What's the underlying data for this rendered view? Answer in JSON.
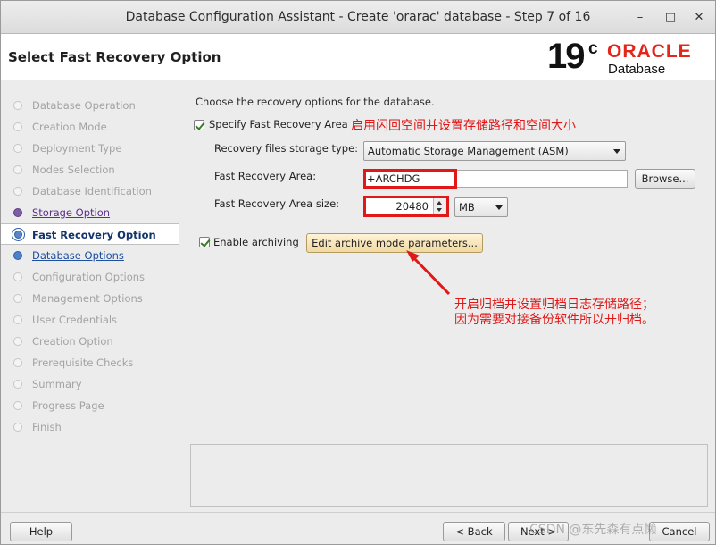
{
  "window": {
    "title": "Database Configuration Assistant - Create 'orarac' database - Step 7 of 16",
    "minimize_glyph": "–",
    "maximize_glyph": "□",
    "close_glyph": "✕"
  },
  "header": {
    "page_title": "Select Fast Recovery Option",
    "logo": {
      "version": "19",
      "suffix": "c",
      "brand": "ORACLE",
      "product": "Database",
      "brand_color": "#e3251b"
    }
  },
  "sidebar": {
    "steps": [
      {
        "label": "Database Operation",
        "state": "disabled"
      },
      {
        "label": "Creation Mode",
        "state": "disabled"
      },
      {
        "label": "Deployment Type",
        "state": "disabled"
      },
      {
        "label": "Nodes Selection",
        "state": "disabled"
      },
      {
        "label": "Database Identification",
        "state": "disabled"
      },
      {
        "label": "Storage Option",
        "state": "done"
      },
      {
        "label": "Fast Recovery Option",
        "state": "current"
      },
      {
        "label": "Database Options",
        "state": "next"
      },
      {
        "label": "Configuration Options",
        "state": "disabled"
      },
      {
        "label": "Management Options",
        "state": "disabled"
      },
      {
        "label": "User Credentials",
        "state": "disabled"
      },
      {
        "label": "Creation Option",
        "state": "disabled"
      },
      {
        "label": "Prerequisite Checks",
        "state": "disabled"
      },
      {
        "label": "Summary",
        "state": "disabled"
      },
      {
        "label": "Progress Page",
        "state": "disabled"
      },
      {
        "label": "Finish",
        "state": "disabled"
      }
    ]
  },
  "main": {
    "description": "Choose the recovery options for the database.",
    "fra_checkbox": {
      "label": "Specify Fast Recovery Area",
      "checked": true
    },
    "fra_annotation": "启用闪回空间并设置存储路径和空间大小",
    "storage_type": {
      "label": "Recovery files storage type:",
      "value": "Automatic Storage Management (ASM)"
    },
    "fra_location": {
      "label": "Fast Recovery Area:",
      "value": "+ARCHDG",
      "browse_label": "Browse..."
    },
    "fra_size": {
      "label": "Fast Recovery Area size:",
      "value": "20480",
      "unit": "MB"
    },
    "archiving": {
      "label": "Enable archiving",
      "checked": true,
      "edit_button": "Edit archive mode parameters..."
    },
    "archive_annotation": {
      "line1": "开启归档并设置归档日志存储路径；",
      "line2": "因为需要对接备份软件所以开归档。"
    },
    "annotation_color": "#e01818"
  },
  "footer": {
    "help": "Help",
    "back": "< Back",
    "next": "Next >",
    "cancel": "Cancel",
    "watermark": "CSDN @东先森有点懒"
  }
}
